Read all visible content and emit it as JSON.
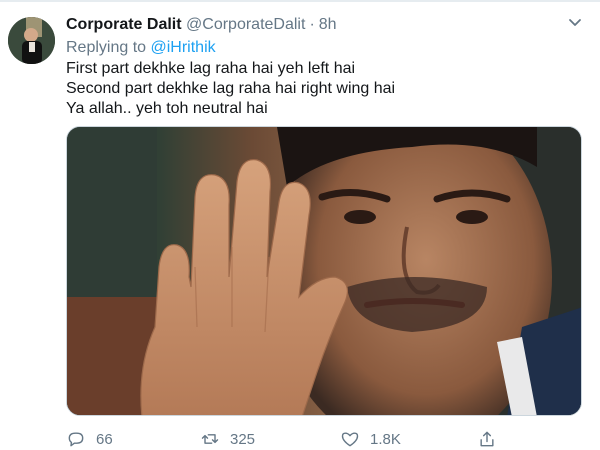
{
  "tweet": {
    "author_name": "Corporate Dalit",
    "author_handle": "@CorporateDalit",
    "separator": "·",
    "time": "8h",
    "replying_prefix": "Replying to",
    "replying_to": "@iHrithik",
    "lines": [
      "First part dekhke lag raha hai yeh left hai",
      "Second part dekhke lag raha hai right wing hai",
      "Ya allah.. yeh toh neutral hai"
    ]
  },
  "actions": {
    "reply_count": "66",
    "retweet_count": "325",
    "like_count": "1.8K"
  },
  "icons": {
    "caret": "chevron-down-icon",
    "reply": "comment-icon",
    "retweet": "retweet-icon",
    "like": "heart-icon",
    "share": "share-icon"
  },
  "colors": {
    "link": "#1da1f2",
    "muted": "#657786",
    "text": "#14171a"
  }
}
